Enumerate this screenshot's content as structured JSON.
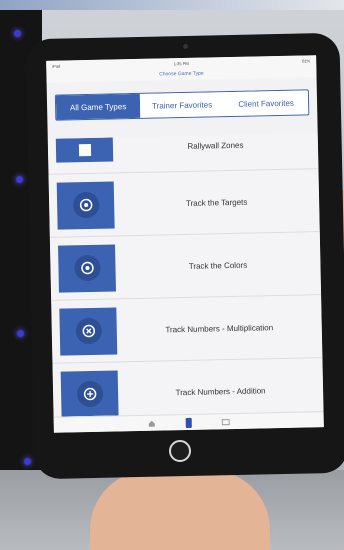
{
  "status_bar": {
    "left": "iPad",
    "time": "1:35 PM",
    "right": "81%"
  },
  "nav": {
    "title": "Choose Game Type"
  },
  "segments": [
    {
      "label": "All Game Types",
      "selected": true
    },
    {
      "label": "Trainer Favorites",
      "selected": false
    },
    {
      "label": "Client Favorites",
      "selected": false
    }
  ],
  "game_list": [
    {
      "label": "Rallywall Zones",
      "icon": "zones-icon"
    },
    {
      "label": "Track the Targets",
      "icon": "target-icon"
    },
    {
      "label": "Track the Colors",
      "icon": "target-icon"
    },
    {
      "label": "Track Numbers - Multiplication",
      "icon": "multiply-icon"
    },
    {
      "label": "Track Numbers - Addition",
      "icon": "plus-icon"
    }
  ],
  "tab_bar": {
    "items": [
      {
        "icon": "home-icon",
        "active": false
      },
      {
        "icon": "games-icon",
        "active": true
      },
      {
        "icon": "stats-icon",
        "active": false
      }
    ]
  },
  "colors": {
    "accent": "#3c63b1",
    "tile_ring": "#2c4f95",
    "screen_bg": "#f2f2f4",
    "case": "#161616"
  }
}
